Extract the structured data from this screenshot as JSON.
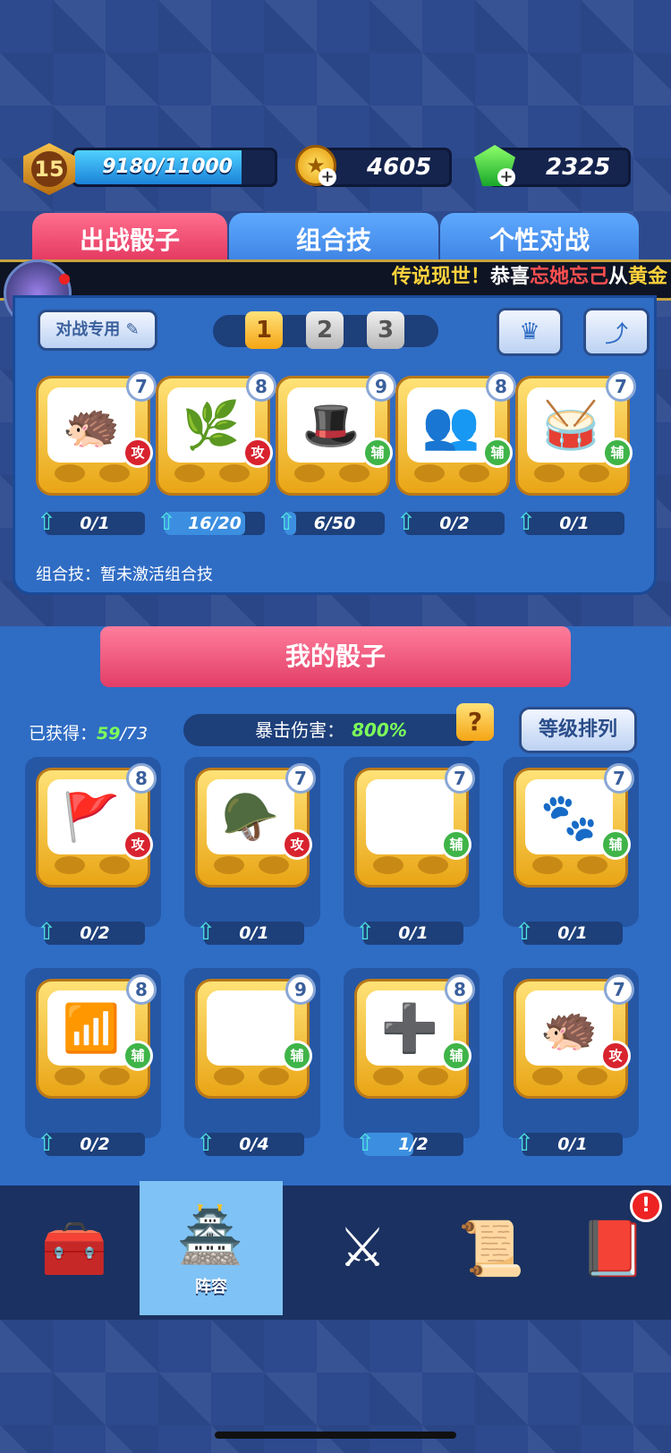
{
  "player": {
    "level": "15",
    "xp_text": "9180/11000",
    "xp_progress": 0.8345
  },
  "resources": {
    "coins": "4605",
    "gems": "2325"
  },
  "tabs": [
    {
      "label": "出战骰子",
      "active": true
    },
    {
      "label": "组合技",
      "active": false
    },
    {
      "label": "个性对战",
      "active": false
    }
  ],
  "ticker": {
    "part1": "传说现世！",
    "part2": "恭喜",
    "part3": "忘她忘己",
    "part4": "从",
    "part5": "黄金"
  },
  "deck": {
    "edit_label": "对战专用",
    "numbers": [
      "1",
      "2",
      "3"
    ],
    "active_index": 0,
    "combo_text": "组合技：暂未激活组合技"
  },
  "battle_dice": [
    {
      "icon": "hair-icon",
      "glyph": "🦔",
      "level": "7",
      "type": "攻",
      "progress_text": "0/1",
      "progress": 0.0
    },
    {
      "icon": "bush-icon",
      "glyph": "🌿",
      "level": "8",
      "type": "攻",
      "progress_text": "16/20",
      "progress": 0.8
    },
    {
      "icon": "magic-hat-icon",
      "glyph": "🎩",
      "level": "9",
      "type": "辅",
      "progress_text": "6/50",
      "progress": 0.12
    },
    {
      "icon": "figures-icon",
      "glyph": "👥",
      "level": "8",
      "type": "辅",
      "progress_text": "0/2",
      "progress": 0.0
    },
    {
      "icon": "red-hat-icon",
      "glyph": "🥁",
      "level": "7",
      "type": "辅",
      "progress_text": "0/1",
      "progress": 0.0
    }
  ],
  "my_dice": {
    "title": "我的骰子",
    "owned_label": "已获得：",
    "owned_count": "59",
    "owned_total": "/73",
    "crit_label": "暴击伤害：",
    "crit_value": "800%",
    "help_label": "?",
    "sort_label": "等级排列",
    "items": [
      {
        "icon": "banner-icon",
        "glyph": "🚩",
        "level": "8",
        "type": "攻",
        "progress_text": "0/2",
        "progress": 0.0
      },
      {
        "icon": "angel-helmet-icon",
        "glyph": "🪖",
        "level": "7",
        "type": "攻",
        "progress_text": "0/1",
        "progress": 0.0
      },
      {
        "icon": "lucky-cat-icon",
        "glyph": "🐱",
        "level": "7",
        "type": "辅",
        "progress_text": "0/1",
        "progress": 0.0
      },
      {
        "icon": "paw-icon",
        "glyph": "🐾",
        "level": "7",
        "type": "辅",
        "progress_text": "0/1",
        "progress": 0.0
      },
      {
        "icon": "signal-icon",
        "glyph": "📶",
        "level": "8",
        "type": "辅",
        "progress_text": "0/2",
        "progress": 0.0
      },
      {
        "icon": "web-icon",
        "glyph": "🕸",
        "level": "9",
        "type": "辅",
        "progress_text": "0/4",
        "progress": 0.0
      },
      {
        "icon": "heal-cross-icon",
        "glyph": "➕",
        "level": "8",
        "type": "辅",
        "progress_text": "1/2",
        "progress": 0.5
      },
      {
        "icon": "hair-icon",
        "glyph": "🦔",
        "level": "7",
        "type": "攻",
        "progress_text": "0/1",
        "progress": 0.0
      }
    ]
  },
  "nav": {
    "items": [
      {
        "icon": "treasure-chest-icon",
        "glyph": "🧰"
      },
      {
        "icon": "cannon-tower-icon",
        "glyph": "🏯",
        "label": "阵容",
        "active": true
      },
      {
        "icon": "crossed-swords-icon",
        "glyph": "⚔"
      },
      {
        "icon": "scroll-icon",
        "glyph": "📜"
      },
      {
        "icon": "spellbook-icon",
        "glyph": "📕"
      }
    ],
    "alert_label": "!"
  },
  "colors": {
    "accent": "#e0305a",
    "panel": "#2f6cc4",
    "gold": "#f5a514",
    "attack": "#d8232f",
    "support": "#3fb448"
  }
}
